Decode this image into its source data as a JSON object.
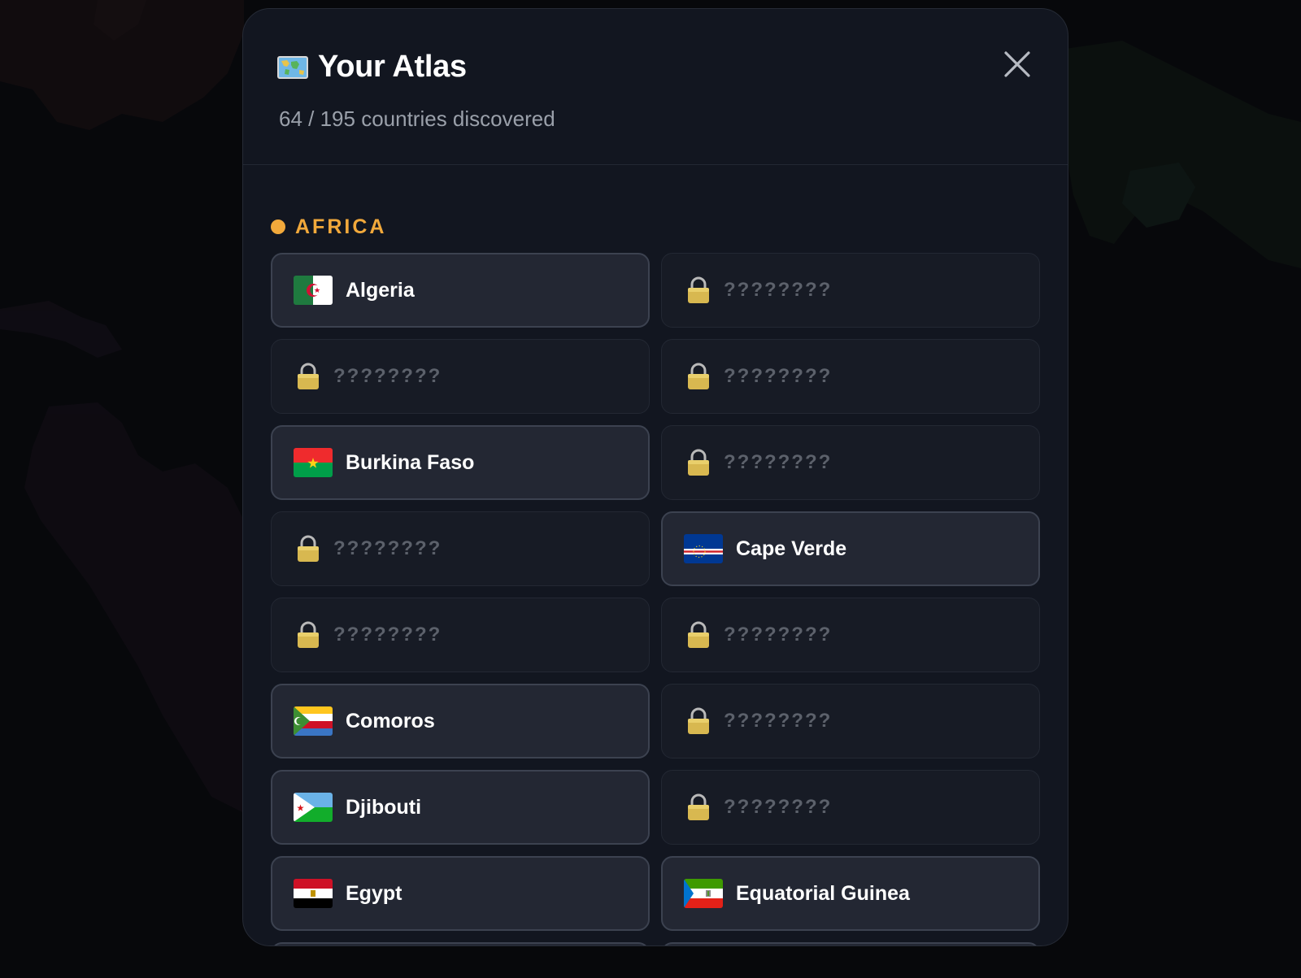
{
  "colors": {
    "region_accent": "#f2a93b",
    "modal_bg": "#121620",
    "card_found_bg": "#232733",
    "card_locked_bg": "#171b25"
  },
  "header": {
    "title_icon": "world-map-icon",
    "title": "Your Atlas",
    "subtitle": "64 / 195 countries discovered",
    "close_icon": "close-icon"
  },
  "region": {
    "label": "AFRICA"
  },
  "cards": [
    {
      "status": "found",
      "name": "Algeria",
      "flag": "flag-algeria-icon"
    },
    {
      "status": "locked",
      "name": "????????",
      "icon": "lock-icon"
    },
    {
      "status": "locked",
      "name": "????????",
      "icon": "lock-icon"
    },
    {
      "status": "locked",
      "name": "????????",
      "icon": "lock-icon"
    },
    {
      "status": "found",
      "name": "Burkina Faso",
      "flag": "flag-burkina-faso-icon"
    },
    {
      "status": "locked",
      "name": "????????",
      "icon": "lock-icon"
    },
    {
      "status": "locked",
      "name": "????????",
      "icon": "lock-icon"
    },
    {
      "status": "found",
      "name": "Cape Verde",
      "flag": "flag-cape-verde-icon"
    },
    {
      "status": "locked",
      "name": "????????",
      "icon": "lock-icon"
    },
    {
      "status": "locked",
      "name": "????????",
      "icon": "lock-icon"
    },
    {
      "status": "found",
      "name": "Comoros",
      "flag": "flag-comoros-icon"
    },
    {
      "status": "locked",
      "name": "????????",
      "icon": "lock-icon"
    },
    {
      "status": "found",
      "name": "Djibouti",
      "flag": "flag-djibouti-icon"
    },
    {
      "status": "locked",
      "name": "????????",
      "icon": "lock-icon"
    },
    {
      "status": "found",
      "name": "Egypt",
      "flag": "flag-egypt-icon"
    },
    {
      "status": "found",
      "name": "Equatorial Guinea",
      "flag": "flag-equatorial-guinea-icon"
    },
    {
      "status": "found",
      "name": "",
      "flag": "flag-partial-icon"
    },
    {
      "status": "found",
      "name": "",
      "flag": "flag-partial-icon"
    }
  ]
}
